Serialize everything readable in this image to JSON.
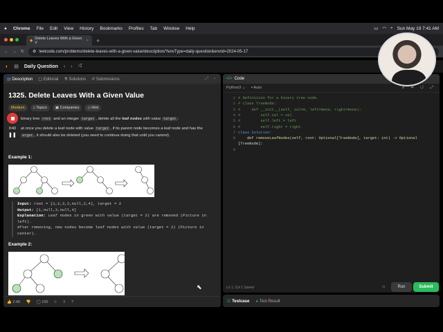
{
  "menubar": {
    "apple": "",
    "app": "Chrome",
    "items": [
      "File",
      "Edit",
      "View",
      "History",
      "Bookmarks",
      "Profiles",
      "Tab",
      "Window",
      "Help"
    ],
    "clock": "Sun May 19  7:41 AM"
  },
  "browser": {
    "tab_title": "Delete Leaves With a Given V",
    "new_tab": "+",
    "url": "leetcode.com/problems/delete-leaves-with-a-given-value/description/?envType=daily-question&envId=2024-05-17"
  },
  "leetcode": {
    "daily_label": "Daily Question",
    "tabs": [
      "Description",
      "Editorial",
      "Solutions",
      "Submissions"
    ],
    "problem_title": "1325. Delete Leaves With a Given Value",
    "tags": [
      "Medium",
      "Topics",
      "Companies",
      "Hint"
    ],
    "recording_time": "0:43",
    "desc_p1_a": "binary tree",
    "desc_p1_code1": "root",
    "desc_p1_b": "and an integer",
    "desc_p1_code2": "target",
    "desc_p1_c": ", delete all the",
    "desc_p1_bold": "leaf nodes",
    "desc_p1_d": "with value",
    "desc_p1_code3": "target",
    "desc_p2_a": "at once you delete a leaf node with value",
    "desc_p2_code": "target",
    "desc_p2_b": ", if its parent node becomes a leaf node and has the",
    "desc_p3_code": "arget",
    "desc_p3_b": ", it should also be deleted (you need to continue doing that until you cannot).",
    "example1": "Example 1:",
    "ex1_input_label": "Input:",
    "ex1_input": "root = [1,2,3,2,null,2,4], target = 2",
    "ex1_output_label": "Output:",
    "ex1_output": "[1,null,3,null,4]",
    "ex1_expl_label": "Explanation:",
    "ex1_expl1": "Leaf nodes in green with value (target = 2) are removed (Picture in left).",
    "ex1_expl2": "After removing, new nodes become leaf nodes with value (target = 2) (Picture in center).",
    "example2": "Example 2:",
    "likes": "2.6K",
    "comments": "100"
  },
  "editor": {
    "header": "Code",
    "language": "Python3",
    "autocomplete": "Auto",
    "lines": [
      "# Definition for a binary tree node.",
      "# class TreeNode:",
      "#     def __init__(self, val=0, left=None, right=None):",
      "#         self.val = val",
      "#         self.left = left",
      "#         self.right = right",
      "class Solution:",
      "    def removeLeafNodes(self, root: Optional[TreeNode], target: int) -> Optional",
      "[TreeNode]:"
    ],
    "line_numbers": [
      "1",
      "2",
      "3",
      "4",
      "5",
      "6",
      "7",
      "8",
      "",
      "9"
    ],
    "status": "Ln 1, Col 1    Saved",
    "run": "Run",
    "submit": "Submit",
    "testcase": "Testcase",
    "test_result": "Test Result"
  },
  "colors": {
    "accent_green": "#2cbb5d",
    "orange": "#ffa116",
    "medium": "#ffc01e",
    "record": "#e23b3b"
  }
}
